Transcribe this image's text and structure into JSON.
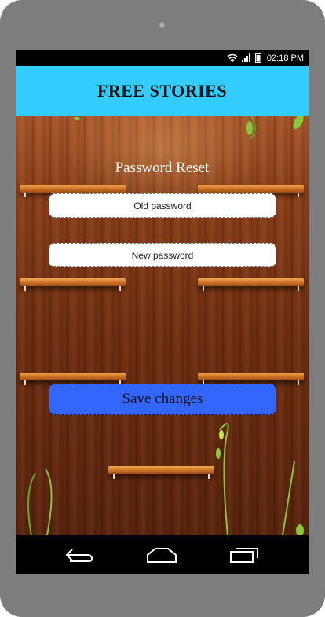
{
  "status_bar": {
    "time": "02:18 PM",
    "icons": [
      "wifi-icon",
      "signal-icon",
      "battery-icon"
    ]
  },
  "app_bar": {
    "title": "FREE STORIES",
    "background_color": "#33ccff"
  },
  "main": {
    "heading": "Password Reset",
    "old_password": {
      "value": "",
      "placeholder": "Old password"
    },
    "new_password": {
      "value": "",
      "placeholder": "New password"
    },
    "save_button": {
      "label": "Save changes",
      "color": "#3366ff"
    }
  },
  "nav_bar": {
    "buttons": [
      "back-icon",
      "home-icon",
      "recent-apps-icon"
    ]
  }
}
